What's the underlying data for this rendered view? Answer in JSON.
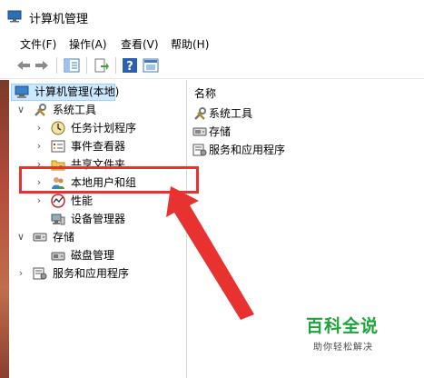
{
  "window": {
    "title": "计算机管理"
  },
  "menu": [
    "文件(F)",
    "操作(A)",
    "查看(V)",
    "帮助(H)"
  ],
  "toolbar": {
    "icons": [
      "back-arrow-icon",
      "forward-arrow-icon",
      "show-tree-icon",
      "export-list-icon",
      "help-icon",
      "properties-icon"
    ]
  },
  "tree": {
    "root": "计算机管理(本地)",
    "system_tools": "系统工具",
    "task_scheduler": "任务计划程序",
    "event_viewer": "事件查看器",
    "shared_folders": "共享文件夹",
    "local_users": "本地用户和组",
    "performance": "性能",
    "device_manager": "设备管理器",
    "storage": "存储",
    "disk_management": "磁盘管理",
    "services_apps": "服务和应用程序"
  },
  "list": {
    "header": "名称",
    "items": [
      "系统工具",
      "存储",
      "服务和应用程序"
    ]
  },
  "annotation": {
    "color": "#e8322f"
  },
  "watermark": {
    "title": "百科全说",
    "subtitle": "助你轻松解决"
  },
  "colors": {
    "selection": "#cce8ff",
    "watermark_green": "#1da43a"
  }
}
